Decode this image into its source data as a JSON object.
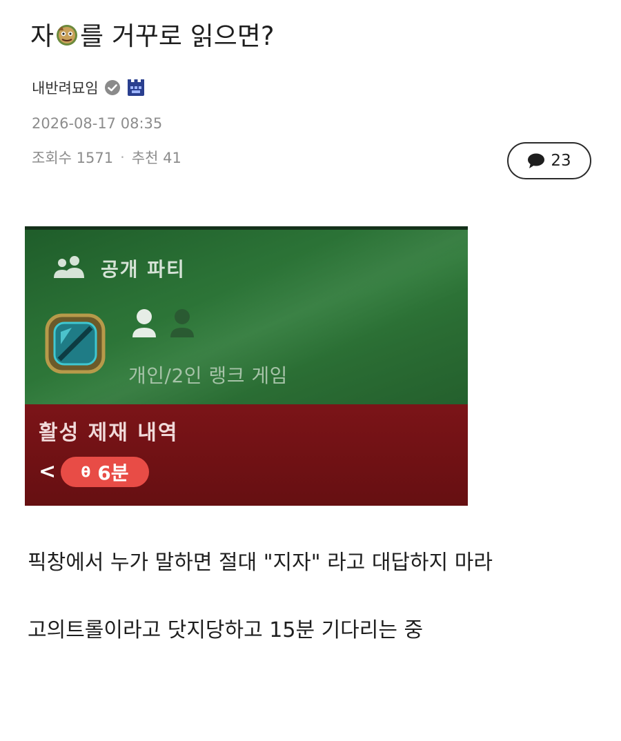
{
  "post": {
    "title_before": "자",
    "title_after": "를 거꾸로 읽으면?",
    "author": "내반려묘임",
    "date": "2026-08-17 08:35",
    "views_label": "조회수 1571",
    "recommend_label": "추천 41",
    "separator": "·",
    "comment_count": "23"
  },
  "game_screenshot": {
    "party_label": "공개 파티",
    "queue_label": "개인/2인 랭크 게임",
    "penalty_title": "활성 제재 내역",
    "chevron": "<",
    "timer_icon": "θ",
    "timer_value": "6분"
  },
  "body": {
    "line1": "픽창에서 누가 말하면 절대 \"지자\" 라고 대답하지 마라",
    "line2": "고의트롤이라고 닷지당하고 15분 기다리는 중"
  },
  "colors": {
    "accent_green": "#2f7a3a",
    "penalty_red": "#7b1418",
    "timer_red": "#e84c46"
  },
  "icons": [
    "emoji-face-icon",
    "verified-badge-icon",
    "level-badge-icon",
    "comment-bubble-icon",
    "party-icon",
    "rank-emblem-icon",
    "person-icon"
  ]
}
